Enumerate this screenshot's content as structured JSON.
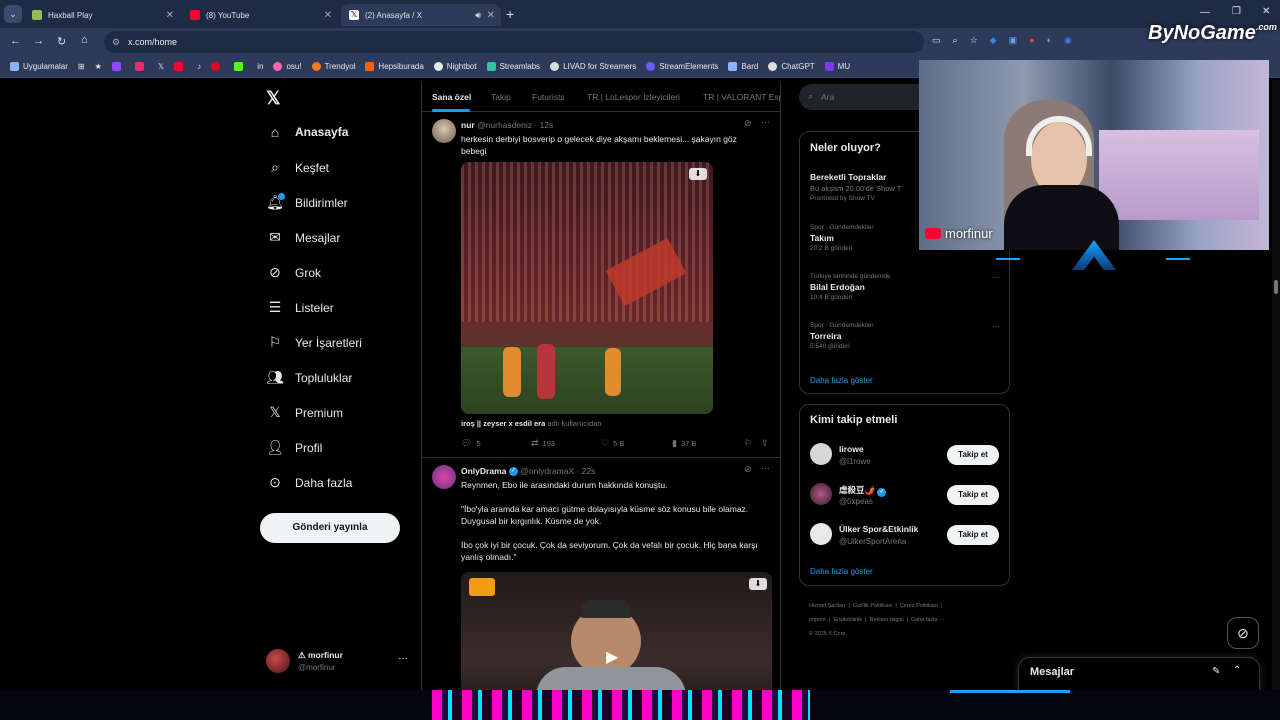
{
  "browser": {
    "tabs": [
      {
        "title": "Haxball Play",
        "active": false
      },
      {
        "title": "(8) YouTube",
        "active": false
      },
      {
        "title": "(2) Anasayfa / X",
        "active": true
      }
    ],
    "url": "x.com/home",
    "bookmarks": [
      "Uygulamalar",
      "osu!",
      "Trendyol",
      "Hepsiburada",
      "Nightbot",
      "Streamlabs",
      "LIVAD for Streamers",
      "StreamElements",
      "Bard",
      "ChatGPT",
      "MU"
    ]
  },
  "overlay": {
    "brand": "ByNoGame",
    "brand_suffix": ".com",
    "streamer": "morfinur"
  },
  "sidebar": {
    "items": [
      {
        "label": "Anasayfa",
        "icon": "home-icon"
      },
      {
        "label": "Keşfet",
        "icon": "search-icon"
      },
      {
        "label": "Bildirimler",
        "icon": "bell-icon"
      },
      {
        "label": "Mesajlar",
        "icon": "mail-icon"
      },
      {
        "label": "Grok",
        "icon": "grok-icon"
      },
      {
        "label": "Listeler",
        "icon": "list-icon"
      },
      {
        "label": "Yer İşaretleri",
        "icon": "bookmark-icon"
      },
      {
        "label": "Topluluklar",
        "icon": "people-icon"
      },
      {
        "label": "Premium",
        "icon": "x-icon"
      },
      {
        "label": "Profil",
        "icon": "user-icon"
      },
      {
        "label": "Daha fazla",
        "icon": "more-circle-icon"
      }
    ],
    "post_button": "Gönderi yayınla",
    "account_name": "⚠ morfinur",
    "account_handle": "@morfinur"
  },
  "feed": {
    "tabs": [
      "Sana özel",
      "Takip",
      "Futurists",
      "TR | LoLespor İzleyicileri",
      "TR | VALORANT Esp"
    ],
    "tweet1": {
      "name": "nur",
      "handle": "@nurhasdeniz · 12s",
      "text": "herkesin derbiyi bosverip o gelecek diye akşamı beklemesi... şakayın göz bebegi",
      "caption_user": "iroş || zeyser x esdil era",
      "caption_suffix": "adlı kullanıcıdan",
      "replies": "5",
      "retweets": "193",
      "likes": "5 B",
      "views": "37 B"
    },
    "tweet2": {
      "name": "OnlyDrama",
      "handle": "@onlydramaX · 22s",
      "line1": "Reynmen, Ebo ile arasındaki durum hakkında konuştu.",
      "line2": "\"İbo'yla aramda kar amacı gütme dolayısıyla küsme söz konusu bile olamaz. Duygusal bir kırgınlık. Küsme de yok.",
      "line3": "İbo çok iyi bir çocuk. Çok da seviyorum. Çok da vefalı bir çocuk. Hiç bana karşı yanlış olmadı.\""
    }
  },
  "right": {
    "search_placeholder": "Ara",
    "trends_title": "Neler oluyor?",
    "trends": [
      {
        "cat": "",
        "name": "Bereketli Topraklar",
        "sub": "Bu akşam 20.00'de Show T",
        "extra": "Promoted by Show TV"
      },
      {
        "cat": "Spor · Gündemdekiler",
        "name": "Takım",
        "sub": "20,2 B gönderi"
      },
      {
        "cat": "Türkiye tarihinde gündemde",
        "name": "Bilal Erdoğan",
        "sub": "10,4 B gönderi"
      },
      {
        "cat": "Spor · Gündemdekiler",
        "name": "Torreira",
        "sub": "5.540 gönderi"
      }
    ],
    "more_link": "Daha fazla göster",
    "who_title": "Kimi takip etmeli",
    "who": [
      {
        "name": "lirowe",
        "handle": "@l1rowe",
        "btn": "Takip et"
      },
      {
        "name": "虐殺豆🌶️",
        "handle": "@0xpeas",
        "btn": "Takip et"
      },
      {
        "name": "Ülker Spor&Etkinlik",
        "handle": "@UlkerSportArena",
        "btn": "Takip et"
      }
    ],
    "who_more": "Daha fazla göster",
    "footer": [
      "Hizmet Şartları",
      "Gizlilik Politikası",
      "Çerez Politikası",
      "Imprint",
      "Erişilebilirlik",
      "Reklam bilgisi",
      "Daha fazla ···",
      "© 2025 X Corp."
    ],
    "messages_title": "Mesajlar"
  }
}
